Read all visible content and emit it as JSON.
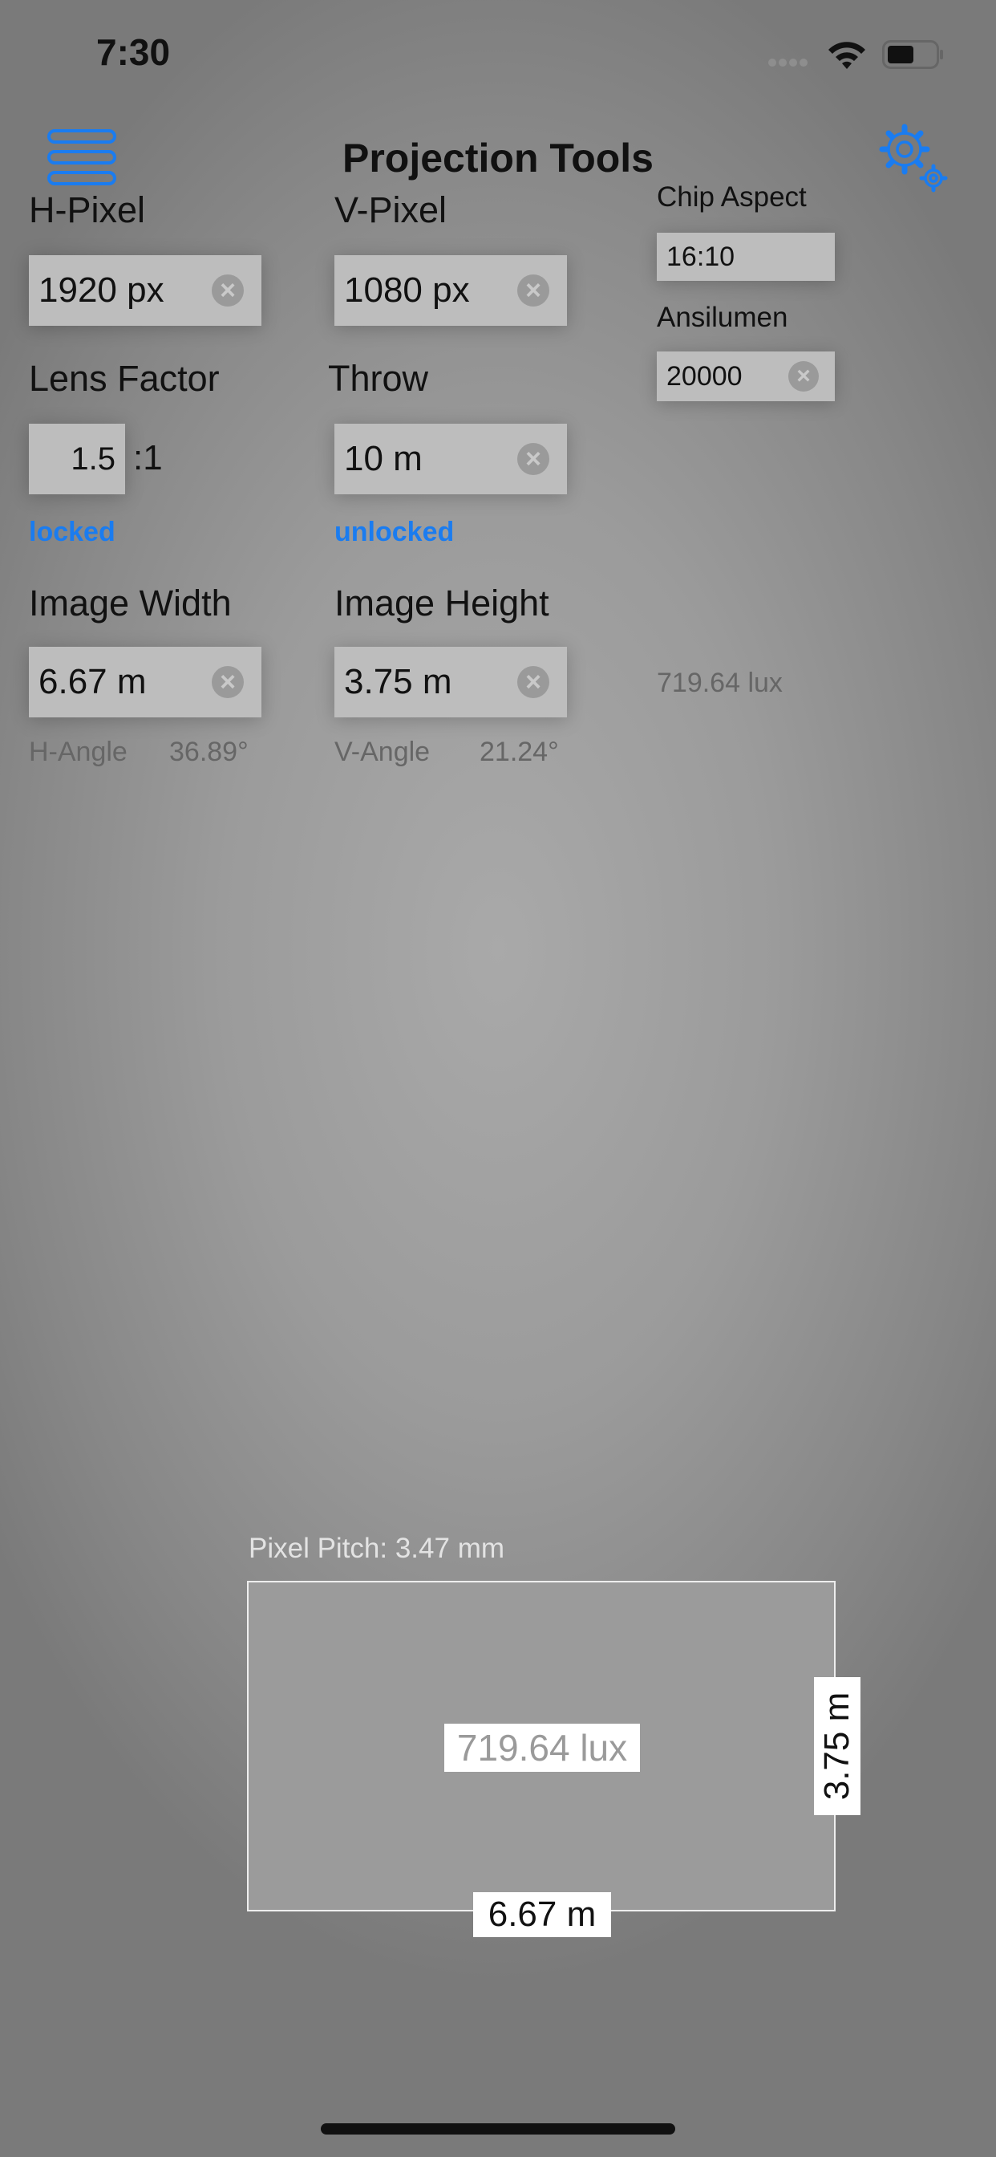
{
  "status_bar": {
    "time": "7:30"
  },
  "header": {
    "title": "Projection Tools",
    "menu_icon": "hamburger-icon",
    "settings_icon": "gear-icon"
  },
  "h_pixel": {
    "label": "H-Pixel",
    "value": "1920 px"
  },
  "v_pixel": {
    "label": "V-Pixel",
    "value": "1080 px"
  },
  "chip_aspect": {
    "label": "Chip Aspect",
    "value": "16:10"
  },
  "ansilumen": {
    "label": "Ansilumen",
    "value": "20000"
  },
  "lens_factor": {
    "label": "Lens Factor",
    "value": "1.5",
    "suffix": ":1",
    "status": "locked"
  },
  "throw": {
    "label": "Throw",
    "value": "10 m",
    "status": "unlocked"
  },
  "image_width": {
    "label": "Image Width",
    "value": "6.67 m"
  },
  "image_height": {
    "label": "Image Height",
    "value": "3.75 m"
  },
  "illuminance": "719.64 lux",
  "h_angle": {
    "label": "H-Angle",
    "value": "36.89°"
  },
  "v_angle": {
    "label": "V-Angle",
    "value": "21.24°"
  },
  "diagram": {
    "pixel_pitch": "Pixel Pitch: 3.47 mm",
    "lux": "719.64 lux",
    "width": "6.67 m",
    "height": "3.75 m"
  },
  "colors": {
    "accent": "#1a7cf0",
    "field_bg": "#bdbdbd"
  }
}
